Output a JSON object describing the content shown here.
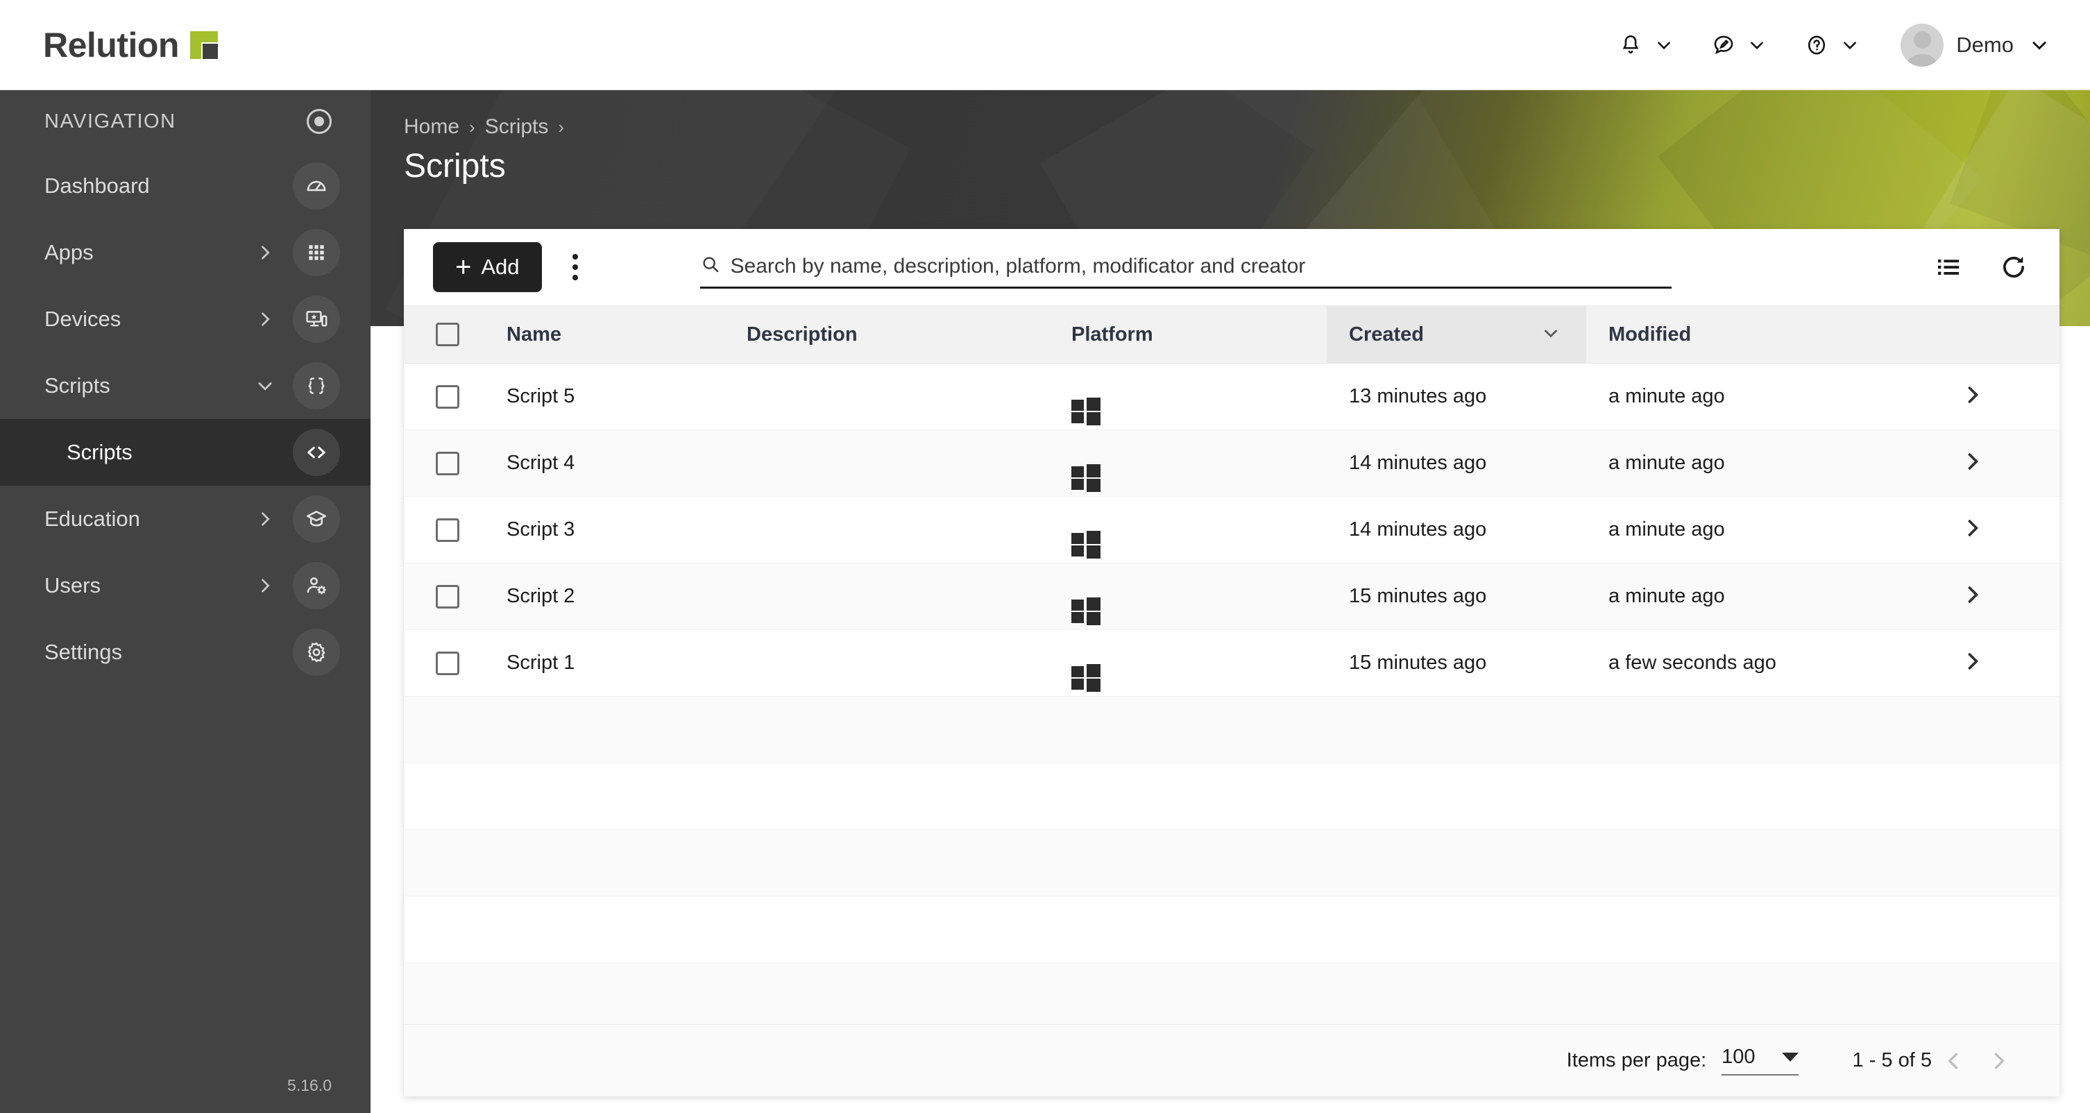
{
  "app": {
    "logo_text": "Relution",
    "version": "5.16.0"
  },
  "topbar": {
    "notifications_icon": "bell-icon",
    "feedback_icon": "feedback-icon",
    "help_icon": "help-icon",
    "user_name": "Demo"
  },
  "sidebar": {
    "heading": "NAVIGATION",
    "items": [
      {
        "label": "Dashboard",
        "icon": "speedometer-icon",
        "expander": "",
        "active": false
      },
      {
        "label": "Apps",
        "icon": "grid-icon",
        "expander": "›",
        "active": false
      },
      {
        "label": "Devices",
        "icon": "devices-icon",
        "expander": "›",
        "active": false
      },
      {
        "label": "Scripts",
        "icon": "braces-icon",
        "expander": "⌄",
        "active": false
      },
      {
        "label": "Scripts",
        "icon": "code-icon",
        "expander": "",
        "active": true,
        "sub": true
      },
      {
        "label": "Education",
        "icon": "graduation-cap-icon",
        "expander": "›",
        "active": false
      },
      {
        "label": "Users",
        "icon": "user-gear-icon",
        "expander": "›",
        "active": false
      },
      {
        "label": "Settings",
        "icon": "gear-icon",
        "expander": "",
        "active": false
      }
    ]
  },
  "hero": {
    "breadcrumb": [
      "Home",
      "Scripts"
    ],
    "separator": "›",
    "title": "Scripts"
  },
  "toolbar": {
    "add_label": "Add",
    "add_plus": "+",
    "menu_icon": "kebab-menu-icon",
    "search_placeholder": "Search by name, description, platform, modificator and creator",
    "search_value": "",
    "search_icon": "search-icon",
    "list_view_icon": "list-view-icon",
    "refresh_icon": "refresh-icon"
  },
  "table": {
    "columns": [
      "Name",
      "Description",
      "Platform",
      "Created",
      "Modified"
    ],
    "sorted_column": "Created",
    "sort_direction": "desc",
    "rows": [
      {
        "name": "Script 5",
        "description": "",
        "platform": "windows",
        "created": "13 minutes ago",
        "modified": "a minute ago"
      },
      {
        "name": "Script 4",
        "description": "",
        "platform": "windows",
        "created": "14 minutes ago",
        "modified": "a minute ago"
      },
      {
        "name": "Script 3",
        "description": "",
        "platform": "windows",
        "created": "14 minutes ago",
        "modified": "a minute ago"
      },
      {
        "name": "Script 2",
        "description": "",
        "platform": "windows",
        "created": "15 minutes ago",
        "modified": "a minute ago"
      },
      {
        "name": "Script 1",
        "description": "",
        "platform": "windows",
        "created": "15 minutes ago",
        "modified": "a few seconds ago"
      }
    ],
    "empty_row_count": 5
  },
  "footer": {
    "items_per_page_label": "Items per page:",
    "items_per_page_value": "100",
    "range_label": "1 - 5 of 5",
    "prev_icon": "chevron-left-icon",
    "next_icon": "chevron-right-icon"
  },
  "colors": {
    "brand_green": "#a4bf2e",
    "sidebar_bg": "#434343",
    "accent_dark": "#212121"
  }
}
